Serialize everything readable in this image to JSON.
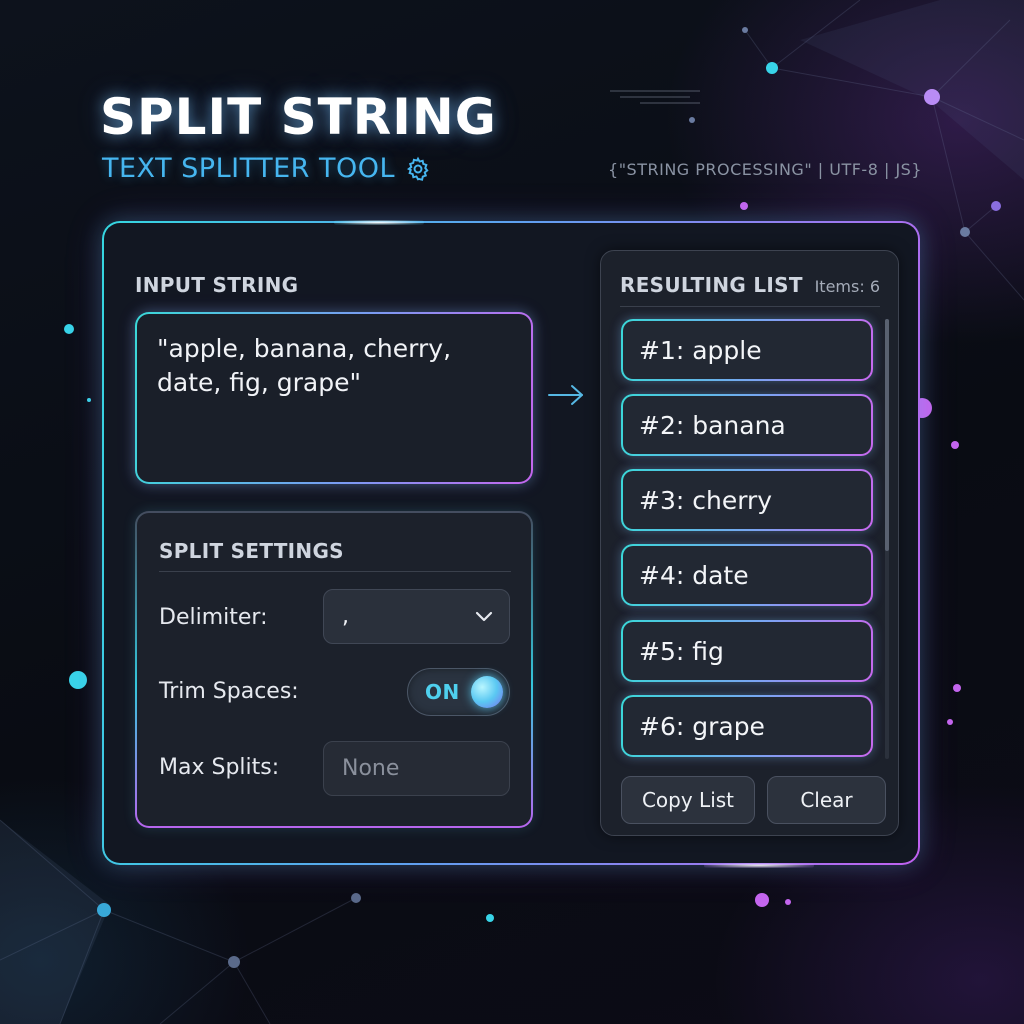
{
  "header": {
    "title": "SPLIT STRING",
    "subtitle": "TEXT SPLITTER TOOL",
    "meta": "{\"STRING PROCESSING\" | UTF-8 | JS}"
  },
  "input": {
    "label": "INPUT STRING",
    "value": "\"apple, banana, cherry,\ndate, fig, grape\""
  },
  "settings": {
    "title": "SPLIT SETTINGS",
    "delimiter_label": "Delimiter:",
    "delimiter_value": ",",
    "trim_label": "Trim Spaces:",
    "trim_state": "ON",
    "max_splits_label": "Max Splits:",
    "max_splits_placeholder": "None"
  },
  "results": {
    "title": "RESULTING LIST",
    "count": "Items: 6",
    "items": [
      "#1: apple",
      "#2: banana",
      "#3: cherry",
      "#4: date",
      "#5: fig",
      "#6: grape"
    ],
    "copy_label": "Copy List",
    "clear_label": "Clear"
  },
  "icons": {
    "settings": "gear-icon",
    "arrow": "arrow-right-icon",
    "dropdown": "chevron-down-icon"
  },
  "colors": {
    "accent_cyan": "#35d6e0",
    "accent_purple": "#c061f0",
    "subtitle_blue": "#46b6f0",
    "background": "#0b0f17"
  }
}
